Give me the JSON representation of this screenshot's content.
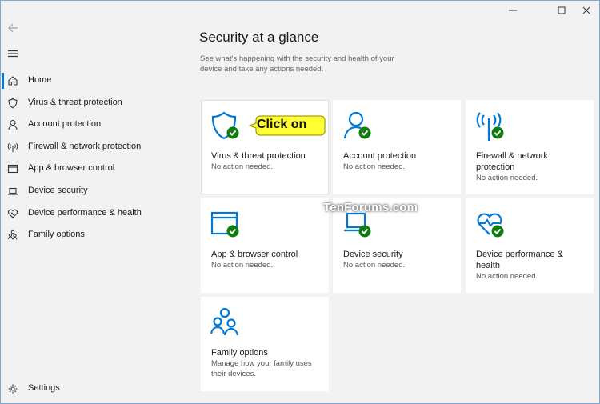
{
  "window_controls": {
    "minimize": "minimize",
    "maximize": "maximize",
    "close": "close"
  },
  "sidebar": {
    "back_label": "Back",
    "menu_label": "Menu",
    "items": [
      {
        "label": "Home",
        "icon": "home-icon",
        "active": true
      },
      {
        "label": "Virus & threat protection",
        "icon": "shield-icon"
      },
      {
        "label": "Account protection",
        "icon": "person-icon"
      },
      {
        "label": "Firewall & network protection",
        "icon": "antenna-icon"
      },
      {
        "label": "App & browser control",
        "icon": "browser-window-icon"
      },
      {
        "label": "Device security",
        "icon": "laptop-icon"
      },
      {
        "label": "Device performance & health",
        "icon": "heart-pulse-icon"
      },
      {
        "label": "Family options",
        "icon": "family-icon"
      }
    ],
    "settings_label": "Settings"
  },
  "main": {
    "title": "Security at a glance",
    "subtitle": "See what's happening with the security and health of your device and take any actions needed.",
    "cards": [
      {
        "title": "Virus & threat protection",
        "status": "No action needed.",
        "icon": "shield-icon",
        "ok": true
      },
      {
        "title": "Account protection",
        "status": "No action needed.",
        "icon": "person-icon",
        "ok": true
      },
      {
        "title": "Firewall & network protection",
        "status": "No action needed.",
        "icon": "antenna-icon",
        "ok": true
      },
      {
        "title": "App & browser control",
        "status": "No action needed.",
        "icon": "browser-window-icon",
        "ok": true
      },
      {
        "title": "Device security",
        "status": "No action needed.",
        "icon": "laptop-icon",
        "ok": true
      },
      {
        "title": "Device performance & health",
        "status": "No action needed.",
        "icon": "heart-pulse-icon",
        "ok": true
      },
      {
        "title": "Family options",
        "status": "Manage how your family uses their devices.",
        "icon": "family-icon",
        "ok": false
      }
    ]
  },
  "annotation": {
    "callout": "Click on",
    "watermark": "TenForums.com"
  },
  "colors": {
    "accent": "#0078d7",
    "ok_green": "#107c10",
    "callout_yellow": "#ffff33"
  }
}
